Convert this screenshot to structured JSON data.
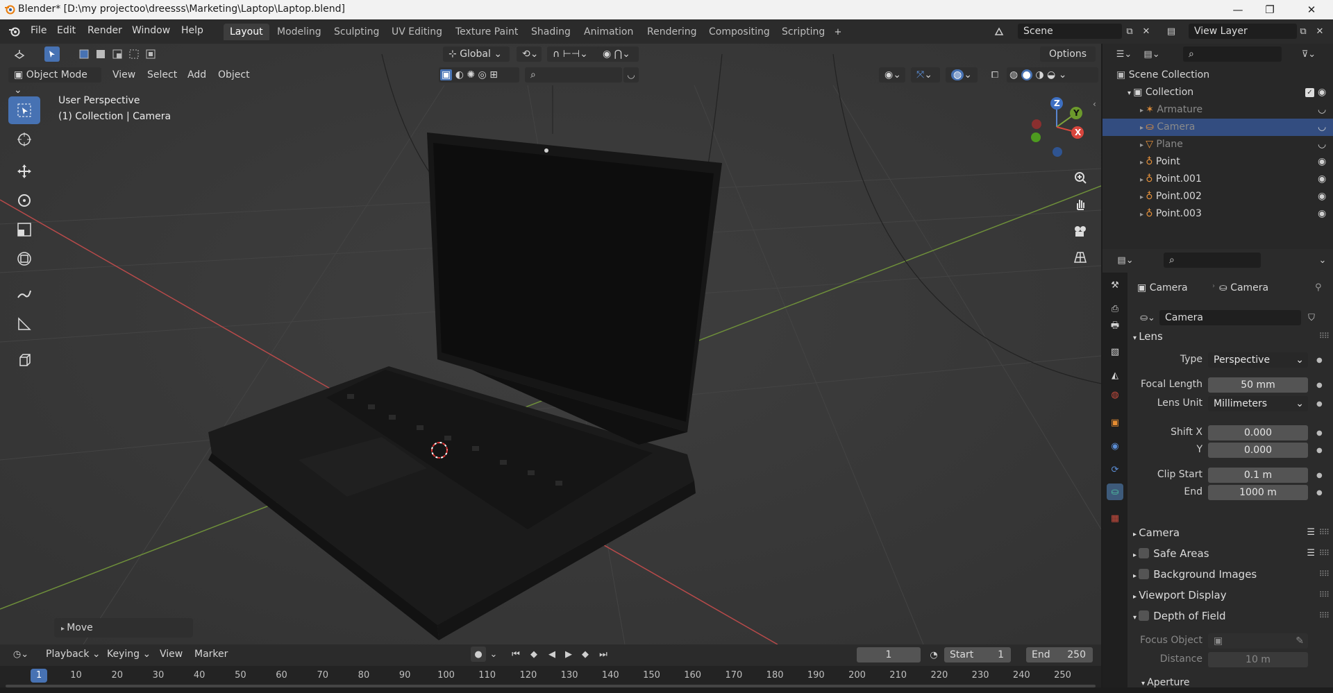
{
  "window": {
    "title": "Blender* [D:\\my projectoo\\dreesss\\Marketing\\Laptop\\Laptop.blend]",
    "minimize": "—",
    "maximize": "❐",
    "close": "✕"
  },
  "menu": [
    "File",
    "Edit",
    "Render",
    "Window",
    "Help"
  ],
  "workspaces": [
    "Layout",
    "Modeling",
    "Sculpting",
    "UV Editing",
    "Texture Paint",
    "Shading",
    "Animation",
    "Rendering",
    "Compositing",
    "Scripting"
  ],
  "active_workspace": "Layout",
  "scene": {
    "name": "Scene",
    "view_layer": "View Layer"
  },
  "viewport": {
    "mode": "Object Mode",
    "menus": [
      "View",
      "Select",
      "Add",
      "Object"
    ],
    "orientation": "Global",
    "options": "Options",
    "perspective": "User Perspective",
    "context": "(1) Collection | Camera",
    "operator_panel": "Move",
    "gizmo": {
      "z": "Z",
      "y": "Y",
      "x": "X"
    },
    "accent": "#4772b3"
  },
  "outliner": {
    "root": "Scene Collection",
    "collection": "Collection",
    "items": [
      {
        "name": "Armature",
        "icon": "armature-icon",
        "dim": true
      },
      {
        "name": "Camera",
        "icon": "camera-object-icon",
        "selected": true,
        "dim": true
      },
      {
        "name": "Plane",
        "icon": "mesh-icon",
        "dim": true
      },
      {
        "name": "Point",
        "icon": "light-icon",
        "dim": false
      },
      {
        "name": "Point.001",
        "icon": "light-icon",
        "dim": false
      },
      {
        "name": "Point.002",
        "icon": "light-icon",
        "dim": false
      },
      {
        "name": "Point.003",
        "icon": "light-icon",
        "dim": false
      }
    ]
  },
  "properties": {
    "breadcrumb": [
      "Camera",
      "Camera"
    ],
    "datablock": "Camera",
    "sections": {
      "lens": "Lens",
      "camera": "Camera",
      "safe_areas": "Safe Areas",
      "background_images": "Background Images",
      "viewport_display": "Viewport Display",
      "depth_of_field": "Depth of Field",
      "aperture": "Aperture"
    },
    "fields": {
      "type_label": "Type",
      "type_value": "Perspective",
      "focal_label": "Focal Length",
      "focal_value": "50 mm",
      "lens_unit_label": "Lens Unit",
      "lens_unit_value": "Millimeters",
      "shift_x_label": "Shift X",
      "shift_x_value": "0.000",
      "shift_y_label": "Y",
      "shift_y_value": "0.000",
      "clip_start_label": "Clip Start",
      "clip_start_value": "0.1 m",
      "clip_end_label": "End",
      "clip_end_value": "1000 m",
      "focus_object_label": "Focus Object",
      "distance_label": "Distance",
      "distance_value": "10 m"
    }
  },
  "timeline": {
    "menus": [
      "Playback",
      "Keying",
      "View",
      "Marker"
    ],
    "current_frame": "1",
    "start_label": "Start",
    "start": "1",
    "end_label": "End",
    "end": "250",
    "ticks": [
      "1",
      "10",
      "20",
      "30",
      "40",
      "50",
      "60",
      "70",
      "80",
      "90",
      "100",
      "110",
      "120",
      "130",
      "140",
      "150",
      "160",
      "170",
      "180",
      "190",
      "200",
      "210",
      "220",
      "230",
      "240",
      "250"
    ]
  }
}
